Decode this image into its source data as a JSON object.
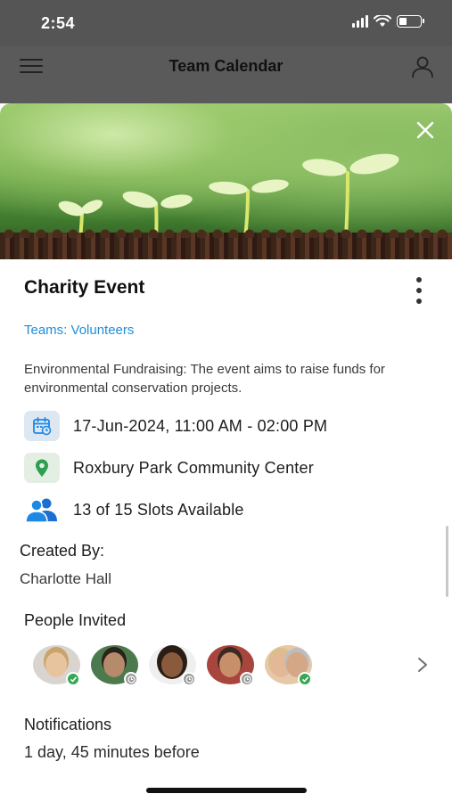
{
  "status_bar": {
    "time": "2:54"
  },
  "nav": {
    "title": "Team Calendar"
  },
  "event": {
    "title": "Charity Event",
    "teams": "Teams: Volunteers",
    "description": "Environmental Fundraising: The event aims to raise funds for environmental conservation projects.",
    "datetime": "17-Jun-2024, 11:00 AM - 02:00 PM",
    "location": "Roxbury Park Community Center",
    "slots": "13 of 15 Slots Available"
  },
  "created_by": {
    "label": "Created By:",
    "name": "Charlotte Hall"
  },
  "people_invited": {
    "label": "People Invited",
    "avatars": [
      {
        "status": "accepted"
      },
      {
        "status": "pending"
      },
      {
        "status": "pending"
      },
      {
        "status": "pending"
      },
      {
        "status": "accepted"
      }
    ]
  },
  "notifications": {
    "label": "Notifications",
    "value": "1 day, 45 minutes before"
  },
  "colors": {
    "link": "#1e8fd6",
    "accepted": "#34a853",
    "pending": "#9a9a9a",
    "icon_blue": "#1e88e5",
    "location_green": "#2e9e4f"
  }
}
